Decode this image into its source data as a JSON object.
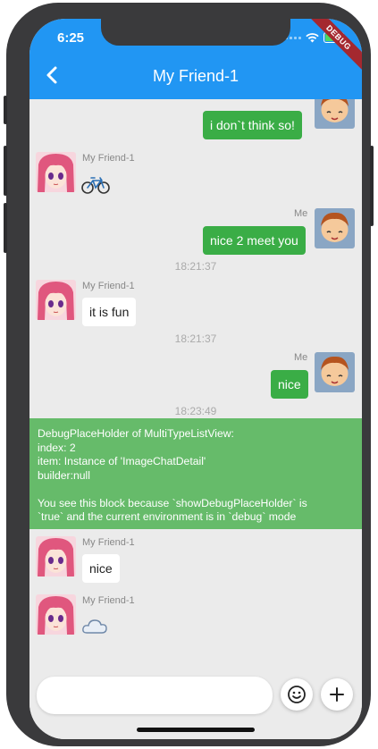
{
  "status_bar": {
    "time": "6:25"
  },
  "app_bar": {
    "title": "My Friend-1",
    "debug_banner": "DEBUG"
  },
  "messages": {
    "m1": {
      "text": "i don`t think so!"
    },
    "m2": {
      "sender": "My Friend-1",
      "sticker": "bicycle-icon"
    },
    "m3": {
      "sender": "Me",
      "text": "nice 2 meet you"
    },
    "ts1": "18:21:37",
    "m4": {
      "sender": "My Friend-1",
      "text": "it is fun"
    },
    "ts2": "18:21:37",
    "m5": {
      "sender": "Me",
      "text": "nice"
    },
    "ts3": "18:23:49",
    "m6": {
      "sender": "My Friend-1",
      "text": "nice"
    },
    "m7": {
      "sender": "My Friend-1",
      "sticker": "cloud-icon"
    }
  },
  "debug_placeholder": {
    "line1": "DebugPlaceHolder of MultiTypeListView:",
    "line2": "index: 2",
    "line3": "item: Instance of 'ImageChatDetail'",
    "line4": "builder:null",
    "line5": "You see this block because `showDebugPlaceHolder` is",
    "line6": "`true` and the current environment is in `debug` mode"
  },
  "input": {
    "value": "",
    "placeholder": ""
  },
  "colors": {
    "app_bar": "#2196f3",
    "me_bubble": "#3aad46",
    "friend_bubble": "#ffffff",
    "debug_block": "#66bb6a",
    "chat_background": "#ebebeb"
  },
  "icons": {
    "back": "chevron-left-icon",
    "emoji": "smiley-icon",
    "add": "plus-icon"
  }
}
